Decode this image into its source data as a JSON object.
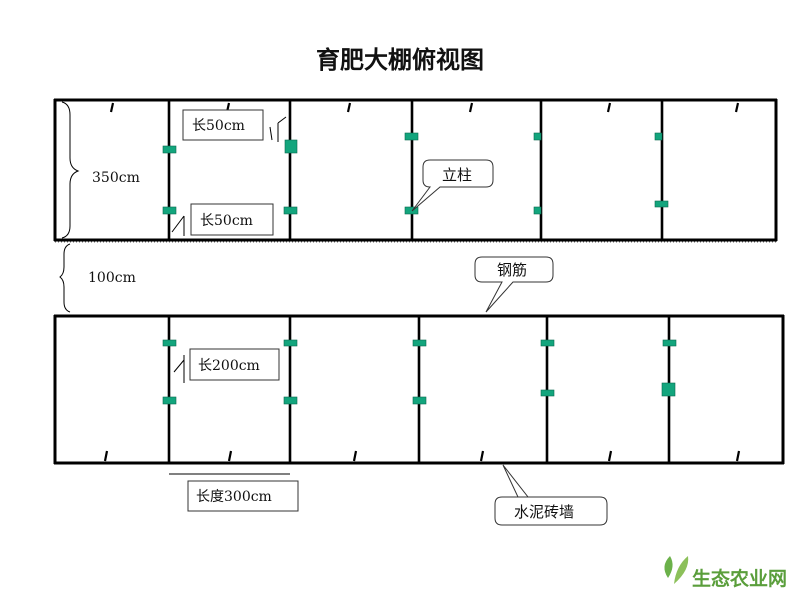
{
  "title": "育肥大棚俯视图",
  "dimensions": {
    "top_depth": "350cm",
    "aisle_width": "100cm",
    "pen_length": "长度300cm"
  },
  "callouts": {
    "width_50_upper": "长50cm",
    "width_50_lower": "长50cm",
    "post": "立柱",
    "steel_bar": "钢筋",
    "width_200": "长200cm",
    "cement_brick_wall": "水泥砖墙"
  },
  "watermark": {
    "text": "生态农业网"
  },
  "colors": {
    "post": "#13a57d",
    "line": "#000000",
    "watermark": "#5a9e3b"
  }
}
